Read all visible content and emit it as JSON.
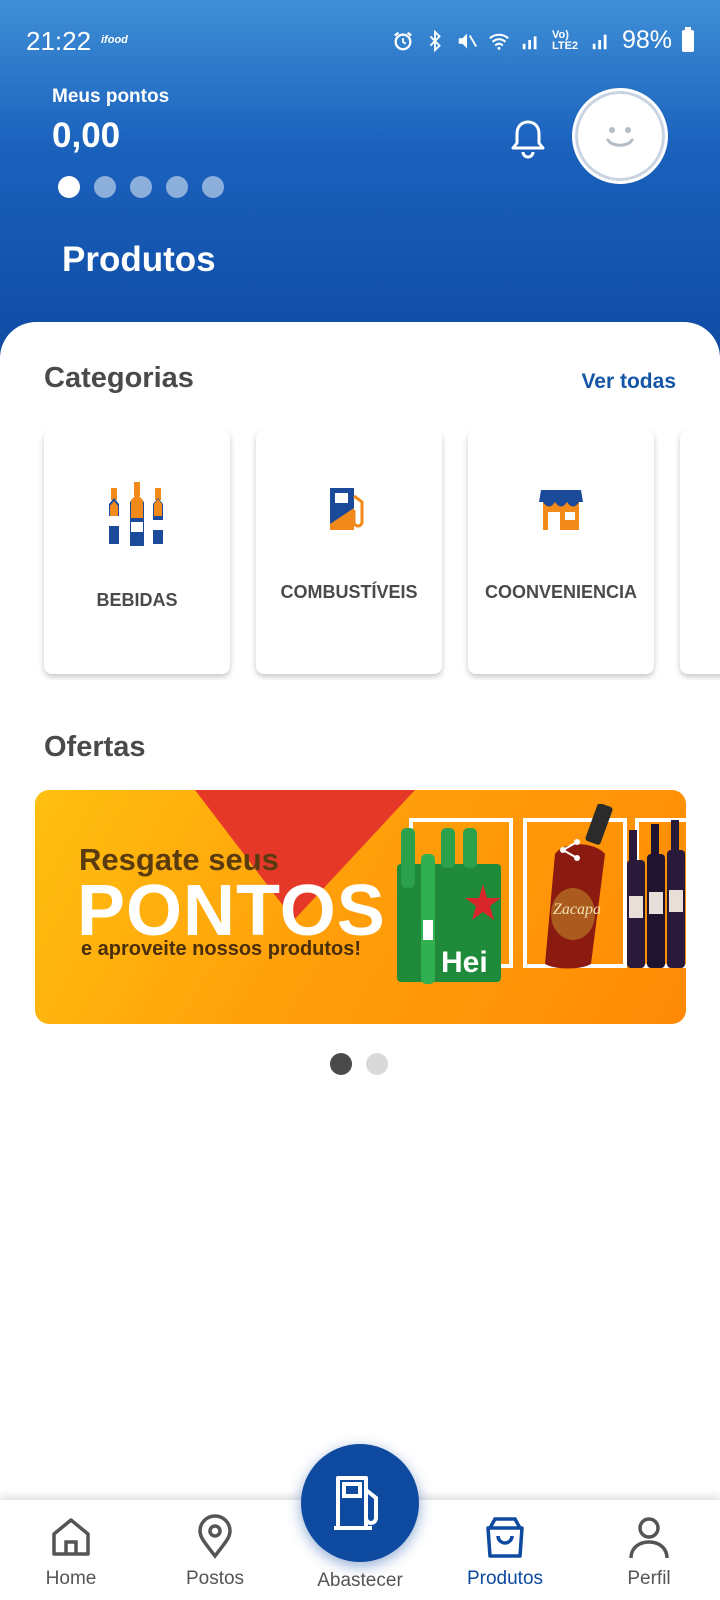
{
  "status_bar": {
    "time": "21:22",
    "app_badge": "ifood",
    "network": "Vo) LTE2",
    "battery": "98%"
  },
  "header": {
    "points_label": "Meus pontos",
    "points_value": "0,00",
    "title": "Produtos"
  },
  "categories": {
    "title": "Categorias",
    "see_all": "Ver todas",
    "items": [
      {
        "label": "BEBIDAS",
        "icon": "bottles-icon"
      },
      {
        "label": "COMBUSTÍVEIS",
        "icon": "fuel-pump-icon"
      },
      {
        "label": "COONVENIENCIA",
        "icon": "store-icon"
      }
    ]
  },
  "offers": {
    "title": "Ofertas",
    "banner": {
      "line1": "Resgate seus",
      "line2": "PONTOS",
      "line3": "e aproveite nossos produtos!",
      "product_text": "Zacapa"
    }
  },
  "bottom_nav": {
    "items": [
      {
        "label": "Home",
        "icon": "home-icon"
      },
      {
        "label": "Postos",
        "icon": "location-pin-icon"
      },
      {
        "label": "Abastecer",
        "icon": "fuel-pump-icon"
      },
      {
        "label": "Produtos",
        "icon": "shopping-bag-icon",
        "active": true
      },
      {
        "label": "Perfil",
        "icon": "person-icon"
      }
    ]
  },
  "colors": {
    "brand_blue": "#0d4aa0",
    "accent_orange": "#f28a1a"
  }
}
